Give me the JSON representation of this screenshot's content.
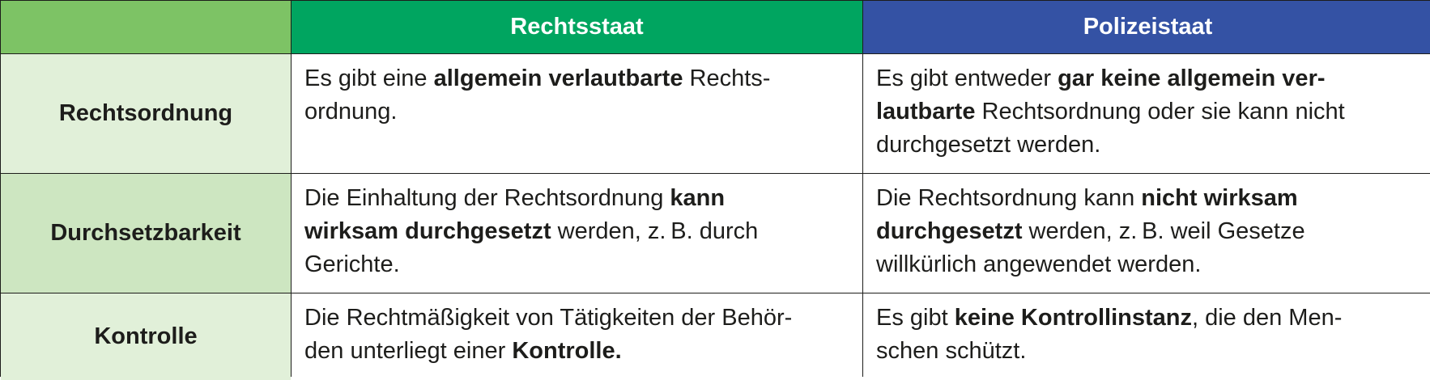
{
  "header": {
    "corner": "",
    "col1": "Rechtsstaat",
    "col2": "Polizeistaat"
  },
  "rows": [
    {
      "label": "Rechtsordnung",
      "rechtsstaat": {
        "l1_a": "Es gibt eine ",
        "l1_b": "allgemein verlautbarte",
        "l1_c": " Rechts-",
        "l2_a": "ordnung."
      },
      "polizeistaat": {
        "l1_a": "Es gibt entweder ",
        "l1_b": "gar keine allgemein ver-",
        "l2_b": "lautbarte",
        "l2_c": " Rechtsordnung oder sie kann nicht",
        "l3_a": "durchgesetzt werden."
      }
    },
    {
      "label": "Durchsetzbarkeit",
      "rechtsstaat": {
        "l1_a": "Die Einhaltung der Rechtsordnung ",
        "l1_b": "kann",
        "l2_b": "wirksam durchgesetzt",
        "l2_c": " werden, z. B. durch",
        "l3_a": "Gerichte."
      },
      "polizeistaat": {
        "l1_a": "Die Rechtsordnung kann ",
        "l1_b": "nicht wirksam",
        "l2_b": "durchgesetzt",
        "l2_c": " werden, z. B. weil Gesetze",
        "l3_a": "willkürlich angewendet werden."
      }
    },
    {
      "label": "Kontrolle",
      "rechtsstaat": {
        "l1_a": "Die Rechtmäßigkeit von Tätigkeiten der Behör-",
        "l2_a": "den unterliegt einer ",
        "l2_b": "Kontrolle."
      },
      "polizeistaat": {
        "l1_a": "Es gibt ",
        "l1_b": "keine Kontrollinstanz",
        "l1_c": ", die den Men-",
        "l2_a": "schen schützt."
      }
    }
  ]
}
